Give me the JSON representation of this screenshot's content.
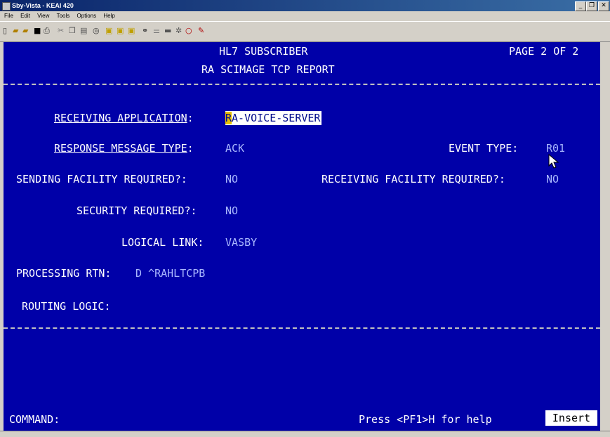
{
  "window": {
    "title": "Sby-Vista - KEAI 420",
    "controls": {
      "minimize": "_",
      "restore": "❐",
      "close": "✕"
    }
  },
  "menu": [
    "File",
    "Edit",
    "View",
    "Tools",
    "Options",
    "Help"
  ],
  "toolbar_icons": [
    "new-icon",
    "open-icon",
    "open-folder-icon",
    "save-icon",
    "print-icon",
    "cut-icon",
    "copy-icon",
    "paste-icon",
    "macro-icon",
    "tile-icon",
    "cascade-icon",
    "window-icon",
    "connect-icon",
    "disconnect-icon",
    "keyboard-icon",
    "settings-icon",
    "stop-icon",
    "edit-icon"
  ],
  "terminal": {
    "header_title": "HL7 SUBSCRIBER",
    "header_subtitle": "RA SCIMAGE TCP REPORT",
    "page": "PAGE 2 OF 2",
    "fields": {
      "receiving_application": {
        "label": "RECEIVING APPLICATION",
        "sep": ":",
        "value_first": "R",
        "value_rest": "A-VOICE-SERVER"
      },
      "response_message_type": {
        "label": "RESPONSE MESSAGE TYPE",
        "sep": ":",
        "value": "ACK"
      },
      "event_type": {
        "label": "EVENT TYPE:",
        "value": "R01"
      },
      "sending_facility_required": {
        "label": "SENDING FACILITY REQUIRED?:",
        "value": "NO"
      },
      "receiving_facility_required": {
        "label": "RECEIVING FACILITY REQUIRED?:",
        "value": "NO"
      },
      "security_required": {
        "label": "SECURITY REQUIRED?:",
        "value": "NO"
      },
      "logical_link": {
        "label": "LOGICAL LINK:",
        "value": "VASBY"
      },
      "processing_rtn": {
        "label": "PROCESSING RTN:",
        "value": "D ^RAHLTCPB"
      },
      "routing_logic": {
        "label": "ROUTING LOGIC:"
      }
    },
    "command_label": "COMMAND:",
    "help_text": "Press <PF1>H for help",
    "mode": "Insert"
  }
}
